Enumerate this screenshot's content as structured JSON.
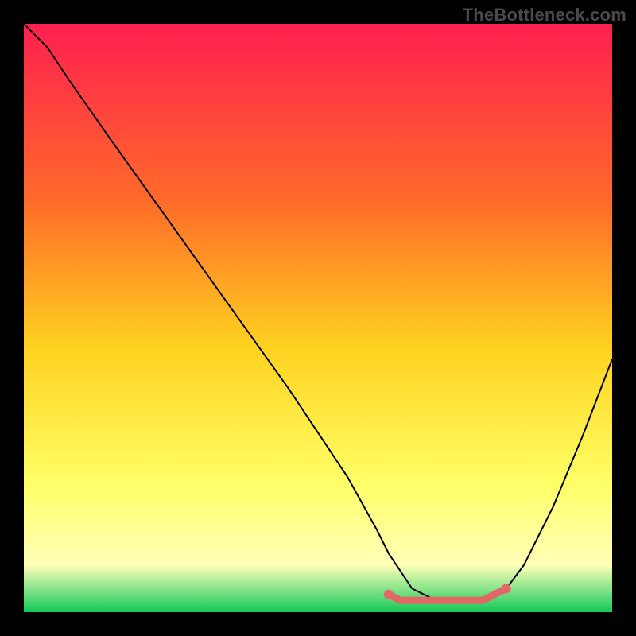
{
  "watermark": "TheBottleneck.com",
  "colors": {
    "background": "#000000",
    "gradient_top": "#ff1f4f",
    "gradient_mid1": "#ff6a2a",
    "gradient_mid2": "#ffd21f",
    "gradient_mid3": "#ffff66",
    "gradient_mid4": "#ffffb8",
    "gradient_bottom": "#12c95a",
    "curve": "#000000",
    "marker": "#e46767"
  },
  "chart_data": {
    "type": "line",
    "title": "",
    "xlabel": "",
    "ylabel": "",
    "xlim": [
      0,
      100
    ],
    "ylim": [
      0,
      100
    ],
    "grid": false,
    "series": [
      {
        "name": "bottleneck-curve",
        "x": [
          0,
          4,
          8,
          15,
          25,
          35,
          45,
          55,
          60,
          62,
          66,
          70,
          74,
          78,
          82,
          85,
          90,
          95,
          100
        ],
        "y": [
          100,
          96,
          90,
          80,
          66,
          52,
          38,
          23,
          14,
          10,
          4,
          2,
          2,
          2,
          4,
          8,
          18,
          30,
          43
        ]
      }
    ],
    "markers": {
      "name": "highlighted-range",
      "x": [
        62,
        64,
        66,
        68,
        70,
        72,
        74,
        76,
        78,
        80,
        82
      ],
      "y": [
        3,
        2,
        2,
        2,
        2,
        2,
        2,
        2,
        2,
        3,
        4
      ]
    },
    "background_gradient": {
      "direction": "vertical",
      "stops": [
        {
          "offset": 0.0,
          "color": "#ff1f4f"
        },
        {
          "offset": 0.3,
          "color": "#ff6a2a"
        },
        {
          "offset": 0.55,
          "color": "#ffd21f"
        },
        {
          "offset": 0.78,
          "color": "#ffff66"
        },
        {
          "offset": 0.92,
          "color": "#ffffb8"
        },
        {
          "offset": 1.0,
          "color": "#12c95a"
        }
      ]
    }
  }
}
